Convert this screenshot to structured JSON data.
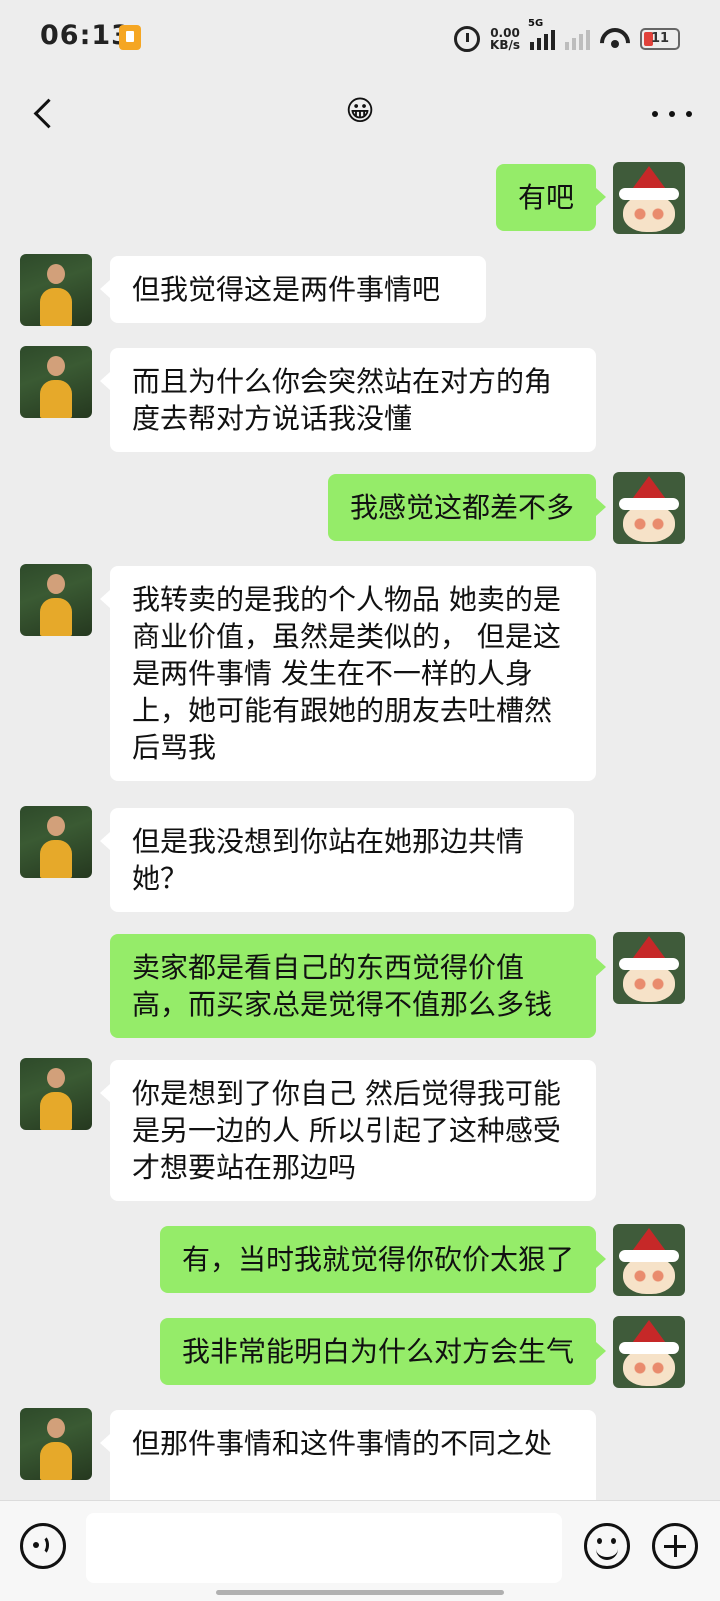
{
  "status_bar": {
    "time": "06:13",
    "net_speed_value": "0.00",
    "net_speed_unit": "KB/s",
    "signal_label": "5G",
    "battery_level": "11",
    "battery_color": "#e0413a"
  },
  "header": {
    "title": "😀",
    "back_icon": "chevron-left-icon",
    "more_icon": "more-dots-icon"
  },
  "messages": [
    {
      "side": "sent",
      "text": "有吧"
    },
    {
      "side": "received",
      "text": "但我觉得这是两件事情吧"
    },
    {
      "side": "received",
      "text": "而且为什么你会突然站在对方的角度去帮对方说话我没懂"
    },
    {
      "side": "sent",
      "text": "我感觉这都差不多"
    },
    {
      "side": "received",
      "text": "我转卖的是我的个人物品 她卖的是商业价值，虽然是类似的， 但是这是两件事情 发生在不一样的人身上，她可能有跟她的朋友去吐槽然后骂我"
    },
    {
      "side": "received",
      "text": "但是我没想到你站在她那边共情她？"
    },
    {
      "side": "sent",
      "text": "卖家都是看自己的东西觉得价值高，而买家总是觉得不值那么多钱"
    },
    {
      "side": "received",
      "text": "你是想到了你自己 然后觉得我可能是另一边的人 所以引起了这种感受才想要站在那边吗"
    },
    {
      "side": "sent",
      "text": "有，当时我就觉得你砍价太狠了"
    },
    {
      "side": "sent",
      "text": "我非常能明白为什么对方会生气"
    },
    {
      "side": "received",
      "text": "但那件事情和这件事情的不同之处"
    }
  ],
  "input_bar": {
    "voice_icon": "voice-icon",
    "emoji_icon": "emoji-icon",
    "plus_icon": "plus-icon",
    "input_value": ""
  },
  "colors": {
    "background": "#ededed",
    "sent_bubble": "#95ec69",
    "received_bubble": "#ffffff"
  }
}
